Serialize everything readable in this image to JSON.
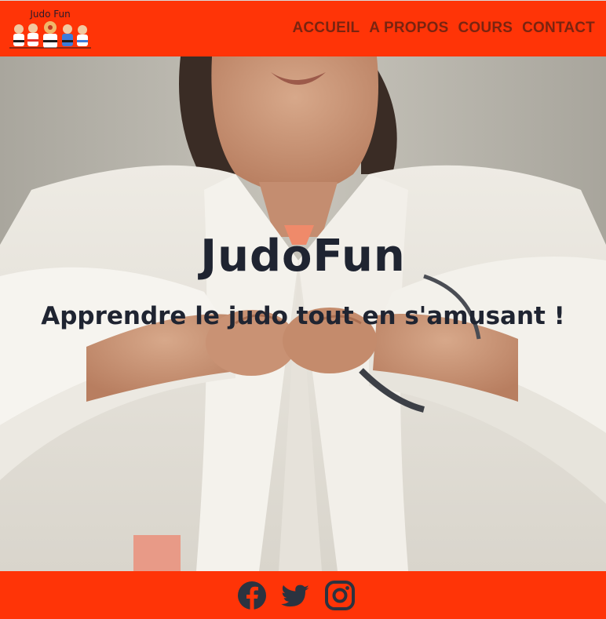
{
  "header": {
    "logo_text": "Judo Fun",
    "nav": [
      {
        "label": "ACCUEIL"
      },
      {
        "label": "A PROPOS"
      },
      {
        "label": "COURS"
      },
      {
        "label": "CONTACT"
      }
    ]
  },
  "hero": {
    "title": "JudoFun",
    "subtitle": "Apprendre le judo tout en s'amusant !"
  },
  "footer": {
    "social": [
      {
        "icon": "facebook-icon"
      },
      {
        "icon": "twitter-icon"
      },
      {
        "icon": "instagram-icon"
      }
    ]
  },
  "colors": {
    "brand": "#ff3407",
    "nav_text": "#7a2410",
    "hero_text": "#1f2431",
    "icons": "#2b3340"
  }
}
